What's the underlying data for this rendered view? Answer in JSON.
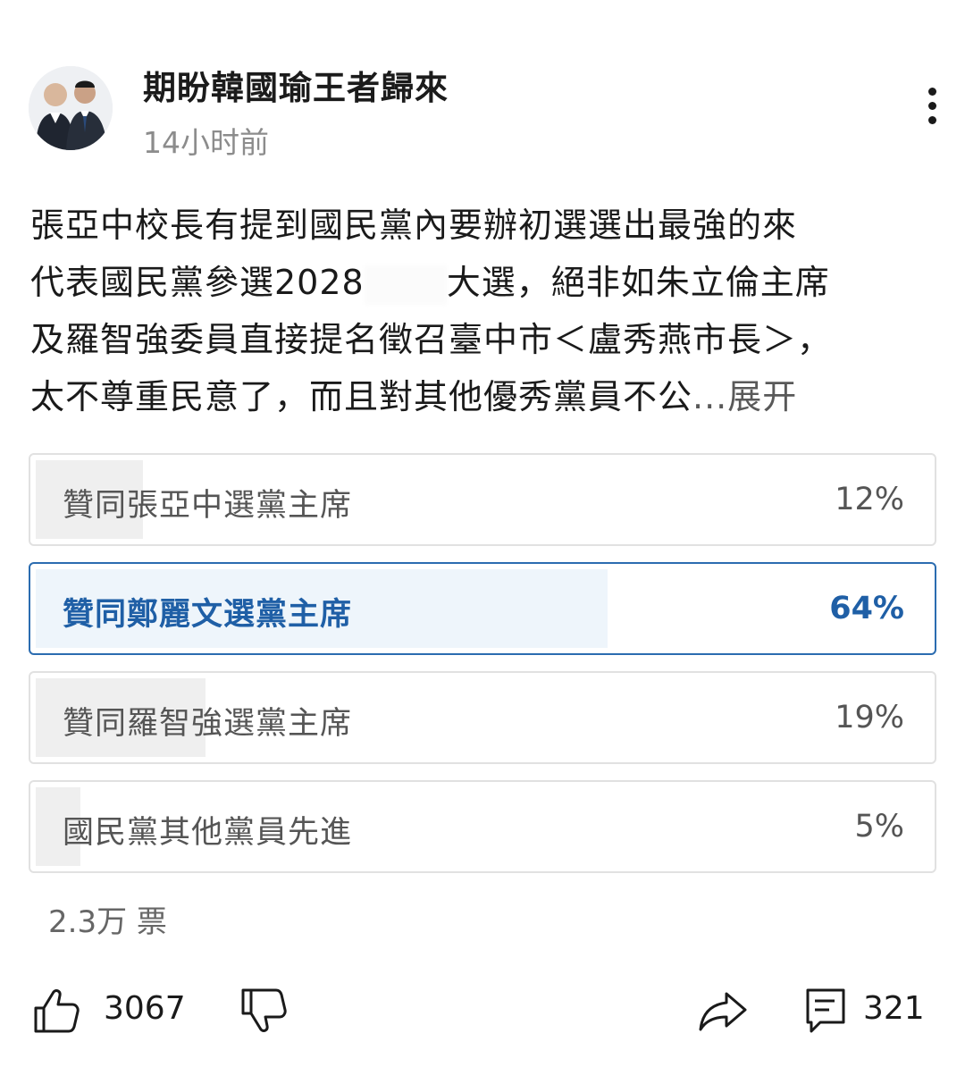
{
  "header": {
    "username": "期盼韓國瑜王者歸來",
    "timestamp": "14小时前",
    "avatar_icon": "avatar-photo",
    "more_icon": "more-vertical-icon"
  },
  "post": {
    "lines": [
      "張亞中校長有提到國民黨內要辦初選選出最強的來",
      "大選，絕非如朱立倫主席",
      "及羅智強委員直接提名徵召臺中市＜盧秀燕市長＞，",
      "太不尊重民意了，而且對其他優秀黨員不公"
    ],
    "line2_prefix": "代表國民黨參選2028",
    "expand_label": "...展开"
  },
  "poll": {
    "options": [
      {
        "label": "贊同張亞中選黨主席",
        "percent": "12%",
        "value": 12,
        "selected": false
      },
      {
        "label": "贊同鄭麗文選黨主席",
        "percent": "64%",
        "value": 64,
        "selected": true
      },
      {
        "label": "贊同羅智強選黨主席",
        "percent": "19%",
        "value": 19,
        "selected": false
      },
      {
        "label": "國民黨其他黨員先進",
        "percent": "5%",
        "value": 5,
        "selected": false
      }
    ],
    "votes": "2.3万 票",
    "accent_color": "#2b6cb0"
  },
  "actions": {
    "like_count": "3067",
    "comment_count": "321",
    "like_icon": "thumbs-up-icon",
    "dislike_icon": "thumbs-down-icon",
    "share_icon": "share-icon",
    "comment_icon": "comment-icon"
  }
}
